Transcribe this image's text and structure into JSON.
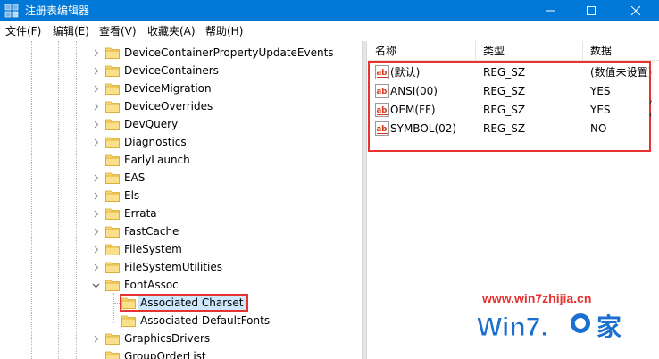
{
  "window": {
    "title": "注册表编辑器",
    "icons": {
      "app": "registry-editor-icon",
      "minimize": "minimize-icon",
      "maximize": "maximize-icon",
      "close": "close-icon"
    }
  },
  "menu": {
    "items": [
      "文件(F)",
      "编辑(E)",
      "查看(V)",
      "收藏夹(A)",
      "帮助(H)"
    ]
  },
  "tree": {
    "items": [
      {
        "label": "DeviceContainerPropertyUpdateEvents",
        "expandable": true
      },
      {
        "label": "DeviceContainers",
        "expandable": true
      },
      {
        "label": "DeviceMigration",
        "expandable": true
      },
      {
        "label": "DeviceOverrides",
        "expandable": true
      },
      {
        "label": "DevQuery",
        "expandable": true
      },
      {
        "label": "Diagnostics",
        "expandable": true
      },
      {
        "label": "EarlyLaunch",
        "expandable": false
      },
      {
        "label": "EAS",
        "expandable": true
      },
      {
        "label": "Els",
        "expandable": true
      },
      {
        "label": "Errata",
        "expandable": true
      },
      {
        "label": "FastCache",
        "expandable": true
      },
      {
        "label": "FileSystem",
        "expandable": true
      },
      {
        "label": "FileSystemUtilities",
        "expandable": true
      },
      {
        "label": "FontAssoc",
        "expandable": true,
        "expanded": true
      },
      {
        "label": "Associated Charset",
        "child": true,
        "selected": true
      },
      {
        "label": "Associated DefaultFonts",
        "child": true
      },
      {
        "label": "GraphicsDrivers",
        "expandable": true
      },
      {
        "label": "GroupOrderList",
        "expandable": false
      }
    ]
  },
  "list": {
    "columns": [
      "名称",
      "类型",
      "数据"
    ],
    "rows": [
      {
        "name": "(默认)",
        "type": "REG_SZ",
        "data": "(数值未设置)"
      },
      {
        "name": "ANSI(00)",
        "type": "REG_SZ",
        "data": "YES"
      },
      {
        "name": "OEM(FF)",
        "type": "REG_SZ",
        "data": "YES"
      },
      {
        "name": "SYMBOL(02)",
        "type": "REG_SZ",
        "data": "NO"
      }
    ],
    "value_icon": "string-value-ab-icon"
  },
  "watermark": {
    "url": "www.win7zhijia.cn",
    "logo_text": "Win7 之家"
  },
  "colors": {
    "titlebar": "#0078d7",
    "annotation_red": "#e8322f",
    "folder": "#f8d775",
    "selection": "#cce8ff"
  }
}
